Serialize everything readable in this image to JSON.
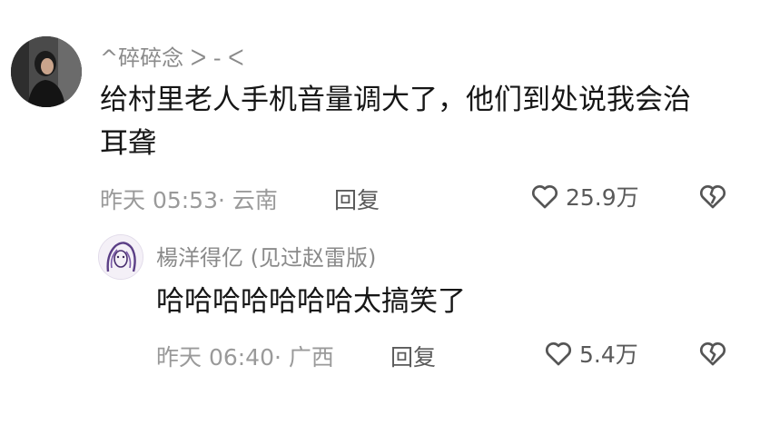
{
  "comments": [
    {
      "username": "^碎碎念 ᐳ - ᐸ",
      "content": "给村里老人手机音量调大了，他们到处说我会治耳聋",
      "time": "昨天 05:53",
      "location": "· 云南",
      "reply_label": "回复",
      "likes": "25.9万",
      "avatar_icon": "user-avatar-photo",
      "like_icon": "heart-outline-icon",
      "dislike_icon": "broken-heart-icon"
    },
    {
      "username": "楊洋得亿 (见过赵雷版)",
      "content": "哈哈哈哈哈哈哈太搞笑了",
      "time": "昨天 06:40",
      "location": "· 广西",
      "reply_label": "回复",
      "likes": "5.4万",
      "avatar_icon": "user-avatar-sketch",
      "like_icon": "heart-outline-icon",
      "dislike_icon": "broken-heart-icon"
    }
  ]
}
